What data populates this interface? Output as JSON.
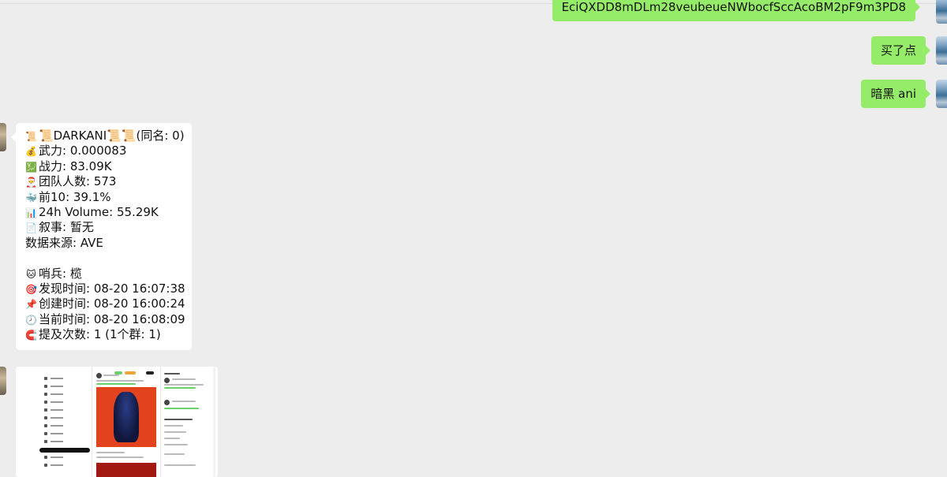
{
  "messages_out": [
    {
      "text": "EciQXDD8mDLm28veubeueNWbocfSccAcoBM2pF9m3PD8"
    },
    {
      "text": "买了点"
    },
    {
      "text": "暗黑 ani"
    }
  ],
  "card": {
    "lines": [
      {
        "icon": "scroll-icon",
        "emoji": "📜",
        "text": "📜DARKANI📜📜(同名: 0)"
      },
      {
        "icon": "money-bag-icon",
        "emoji": "💰",
        "text": "武力: 0.000083"
      },
      {
        "icon": "chart-up-icon",
        "emoji": "💹",
        "text": "战力: 83.09K"
      },
      {
        "icon": "santa-icon",
        "emoji": "🎅",
        "text": "团队人数: 573"
      },
      {
        "icon": "whale-icon",
        "emoji": "🐳",
        "text": "前10: 39.1%"
      },
      {
        "icon": "bar-chart-icon",
        "emoji": "📊",
        "text": "24h Volume: 55.29K"
      },
      {
        "icon": "memo-icon",
        "emoji": "📄",
        "text": "叙事: 暂无"
      },
      {
        "icon": "",
        "emoji": "",
        "text": "数据来源: AVE"
      },
      {
        "icon": "",
        "emoji": "",
        "text": ""
      },
      {
        "icon": "cat-icon",
        "emoji": "🐱",
        "text": "哨兵: 榄"
      },
      {
        "icon": "target-icon",
        "emoji": "🎯",
        "text": "发现时间: 08-20 16:07:38"
      },
      {
        "icon": "pushpin-icon",
        "emoji": "📌",
        "text": "创建时间: 08-20 16:00:24"
      },
      {
        "icon": "clock-icon",
        "emoji": "🕗",
        "text": "当前时间: 08-20 16:08:09"
      },
      {
        "icon": "magnet-icon",
        "emoji": "🧲",
        "text": "提及次数: 1 (1个群: 1)"
      }
    ]
  },
  "colors": {
    "background": "#ededed",
    "own_bubble": "#95ec69",
    "card": "#ffffff"
  }
}
